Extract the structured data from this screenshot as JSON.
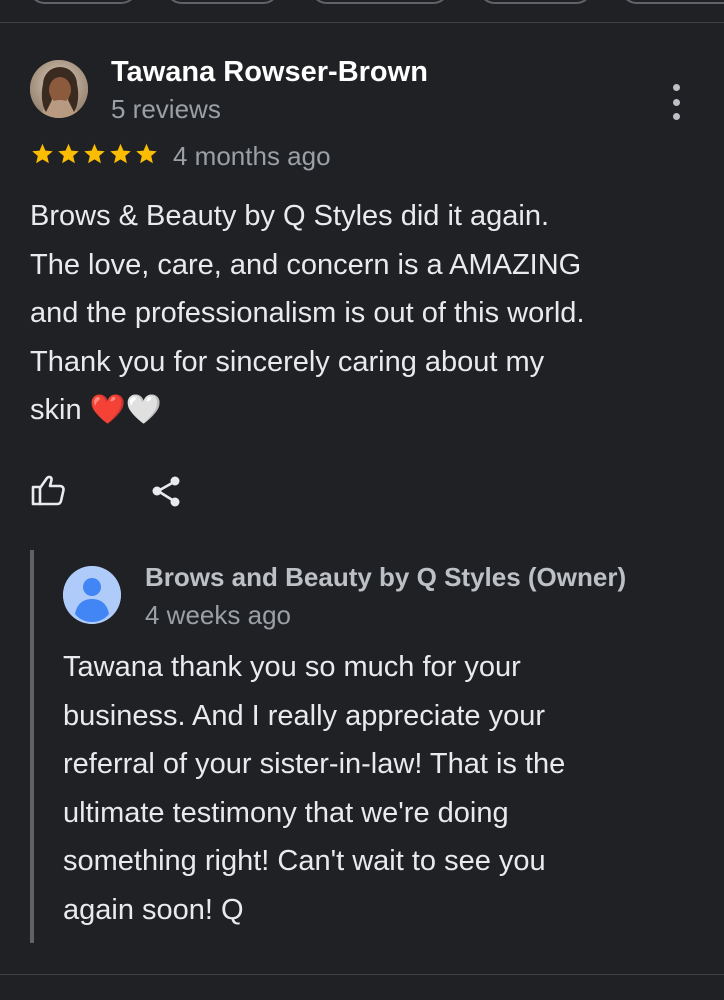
{
  "review": {
    "reviewer_name": "Tawana Rowser-Brown",
    "reviewer_meta": "5 reviews",
    "rating": 5,
    "rating_max": 5,
    "date": "4 months ago",
    "text_lines": [
      "Brows & Beauty by Q Styles did it again.",
      "The love, care, and concern is a AMAZING",
      "and the professionalism is out of this world.",
      "Thank you for sincerely caring about my",
      "skin ❤️🤍"
    ]
  },
  "owner_response": {
    "name": "Brows and Beauty by Q Styles (Owner)",
    "date": "4 weeks ago",
    "text_lines": [
      "Tawana thank you so much for your",
      "business. And I really appreciate your",
      "referral of your sister-in-law! That is the",
      "ultimate testimony that we're doing",
      "something right! Can't wait to see you",
      "again soon! Q"
    ]
  },
  "icons": {
    "more": "more-vert-icon",
    "like": "thumb-up-icon",
    "share": "share-icon",
    "star": "star-icon",
    "owner_avatar": "person-icon"
  },
  "colors": {
    "background": "#202124",
    "star": "#fbbc04",
    "owner_avatar_bg": "#aecbfa",
    "owner_avatar_fg": "#4285f4"
  }
}
